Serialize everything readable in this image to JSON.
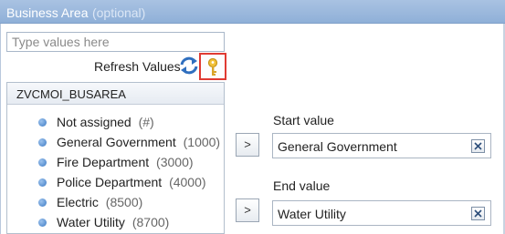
{
  "header": {
    "title": "Business Area",
    "optional_label": "(optional)"
  },
  "search": {
    "placeholder": "Type values here",
    "value": ""
  },
  "refresh": {
    "label": "Refresh Values",
    "refresh_icon": "refresh-icon",
    "key_icon": "key-icon"
  },
  "list": {
    "header": "ZVCMOI_BUSAREA",
    "items": [
      {
        "label": "Not assigned",
        "code": "(#)"
      },
      {
        "label": "General Government",
        "code": "(1000)"
      },
      {
        "label": "Fire Department",
        "code": "(3000)"
      },
      {
        "label": "Police Department",
        "code": "(4000)"
      },
      {
        "label": "Electric",
        "code": "(8500)"
      },
      {
        "label": "Water Utility",
        "code": "(8700)"
      }
    ]
  },
  "start": {
    "label": "Start value",
    "value": "General Government",
    "move_label": ">"
  },
  "end": {
    "label": "End value",
    "value": "Water Utility",
    "move_label": ">"
  },
  "colors": {
    "header": "#9bb8de",
    "highlight_border": "#e03b33",
    "bullet": "#3e7bc4"
  }
}
